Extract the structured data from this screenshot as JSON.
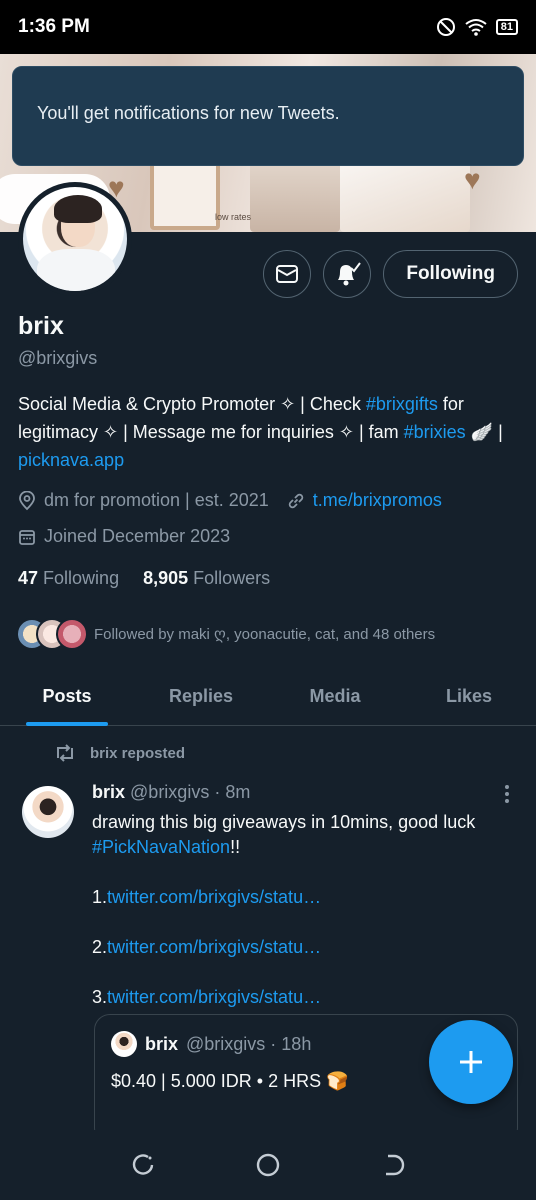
{
  "status_bar": {
    "time": "1:36 PM",
    "battery": "81"
  },
  "toast": {
    "text": "You'll get notifications for new Tweets."
  },
  "banner": {
    "caption": "low rates"
  },
  "profile": {
    "name": "brix",
    "handle": "@brixgivs",
    "bio_1": "Social Media & Crypto Promoter ✧ | Check ",
    "bio_hashtag_1": "#brixgifts",
    "bio_2": " for legitimacy ✧ | Message me for inquiries ✧ | fam ",
    "bio_hashtag_2": "#brixies",
    "bio_3": " 🪽 | ",
    "bio_link": "picknava.app",
    "location": "dm for promotion | est. 2021",
    "website": "t.me/brixpromos",
    "joined": "Joined December 2023",
    "following_count": "47",
    "following_label": "Following",
    "followers_count": "8,905",
    "followers_label": "Followers",
    "followed_by": "Followed by maki ღ, yoonacutie, cat, and 48 others"
  },
  "actions": {
    "following_label": "Following"
  },
  "tabs": [
    {
      "label": "Posts"
    },
    {
      "label": "Replies"
    },
    {
      "label": "Media"
    },
    {
      "label": "Likes"
    }
  ],
  "tweet": {
    "repost_label": "brix reposted",
    "author": "brix",
    "handle_time": "@brixgivs · 8m",
    "line1": "drawing this big giveaways in 10mins, good luck",
    "hashtag": "#PickNavaNation",
    "hashtag_suffix": "!!",
    "link1_prefix": "1.",
    "link1": "twitter.com/brixgivs/statu…",
    "link2_prefix": "2.",
    "link2": "twitter.com/brixgivs/statu…",
    "link3_prefix": "3.",
    "link3": "twitter.com/brixgivs/statu…"
  },
  "quote": {
    "author": "brix",
    "handle_time": "@brixgivs · 18h",
    "text": "$0.40 | 5.000 IDR • 2 HRS 🍞"
  },
  "colors": {
    "accent": "#1d9bf0",
    "background": "#15202b",
    "toast": "#1f3b51"
  },
  "icons": [
    "no-disturb-icon",
    "wifi-icon",
    "battery-icon",
    "mail-icon",
    "bell-check-icon",
    "location-icon",
    "link-icon",
    "calendar-icon",
    "repost-icon",
    "more-icon",
    "plus-icon",
    "nav-recent-icon",
    "nav-home-icon",
    "nav-back-icon"
  ]
}
